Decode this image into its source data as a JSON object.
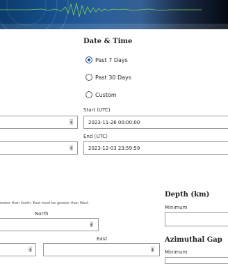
{
  "date_time": {
    "heading": "Date & Time",
    "options": [
      "Past 7 Days",
      "Past 30 Days",
      "Custom"
    ],
    "selected": "Past 7 Days",
    "start_label": "Start (UTC)",
    "start_value": "2023-11-26 00:00:00",
    "end_label": "End (UTC)",
    "end_value": "2023-12-03 23:59:59"
  },
  "geographic": {
    "help_text": "reater than South. East must be greater than West.",
    "north_label": "North",
    "east_label": "East"
  },
  "depth": {
    "heading": "Depth (km)",
    "min_label": "Minimum"
  },
  "azimuthal_gap": {
    "heading": "Azimuthal Gap",
    "min_label": "Minimum"
  }
}
